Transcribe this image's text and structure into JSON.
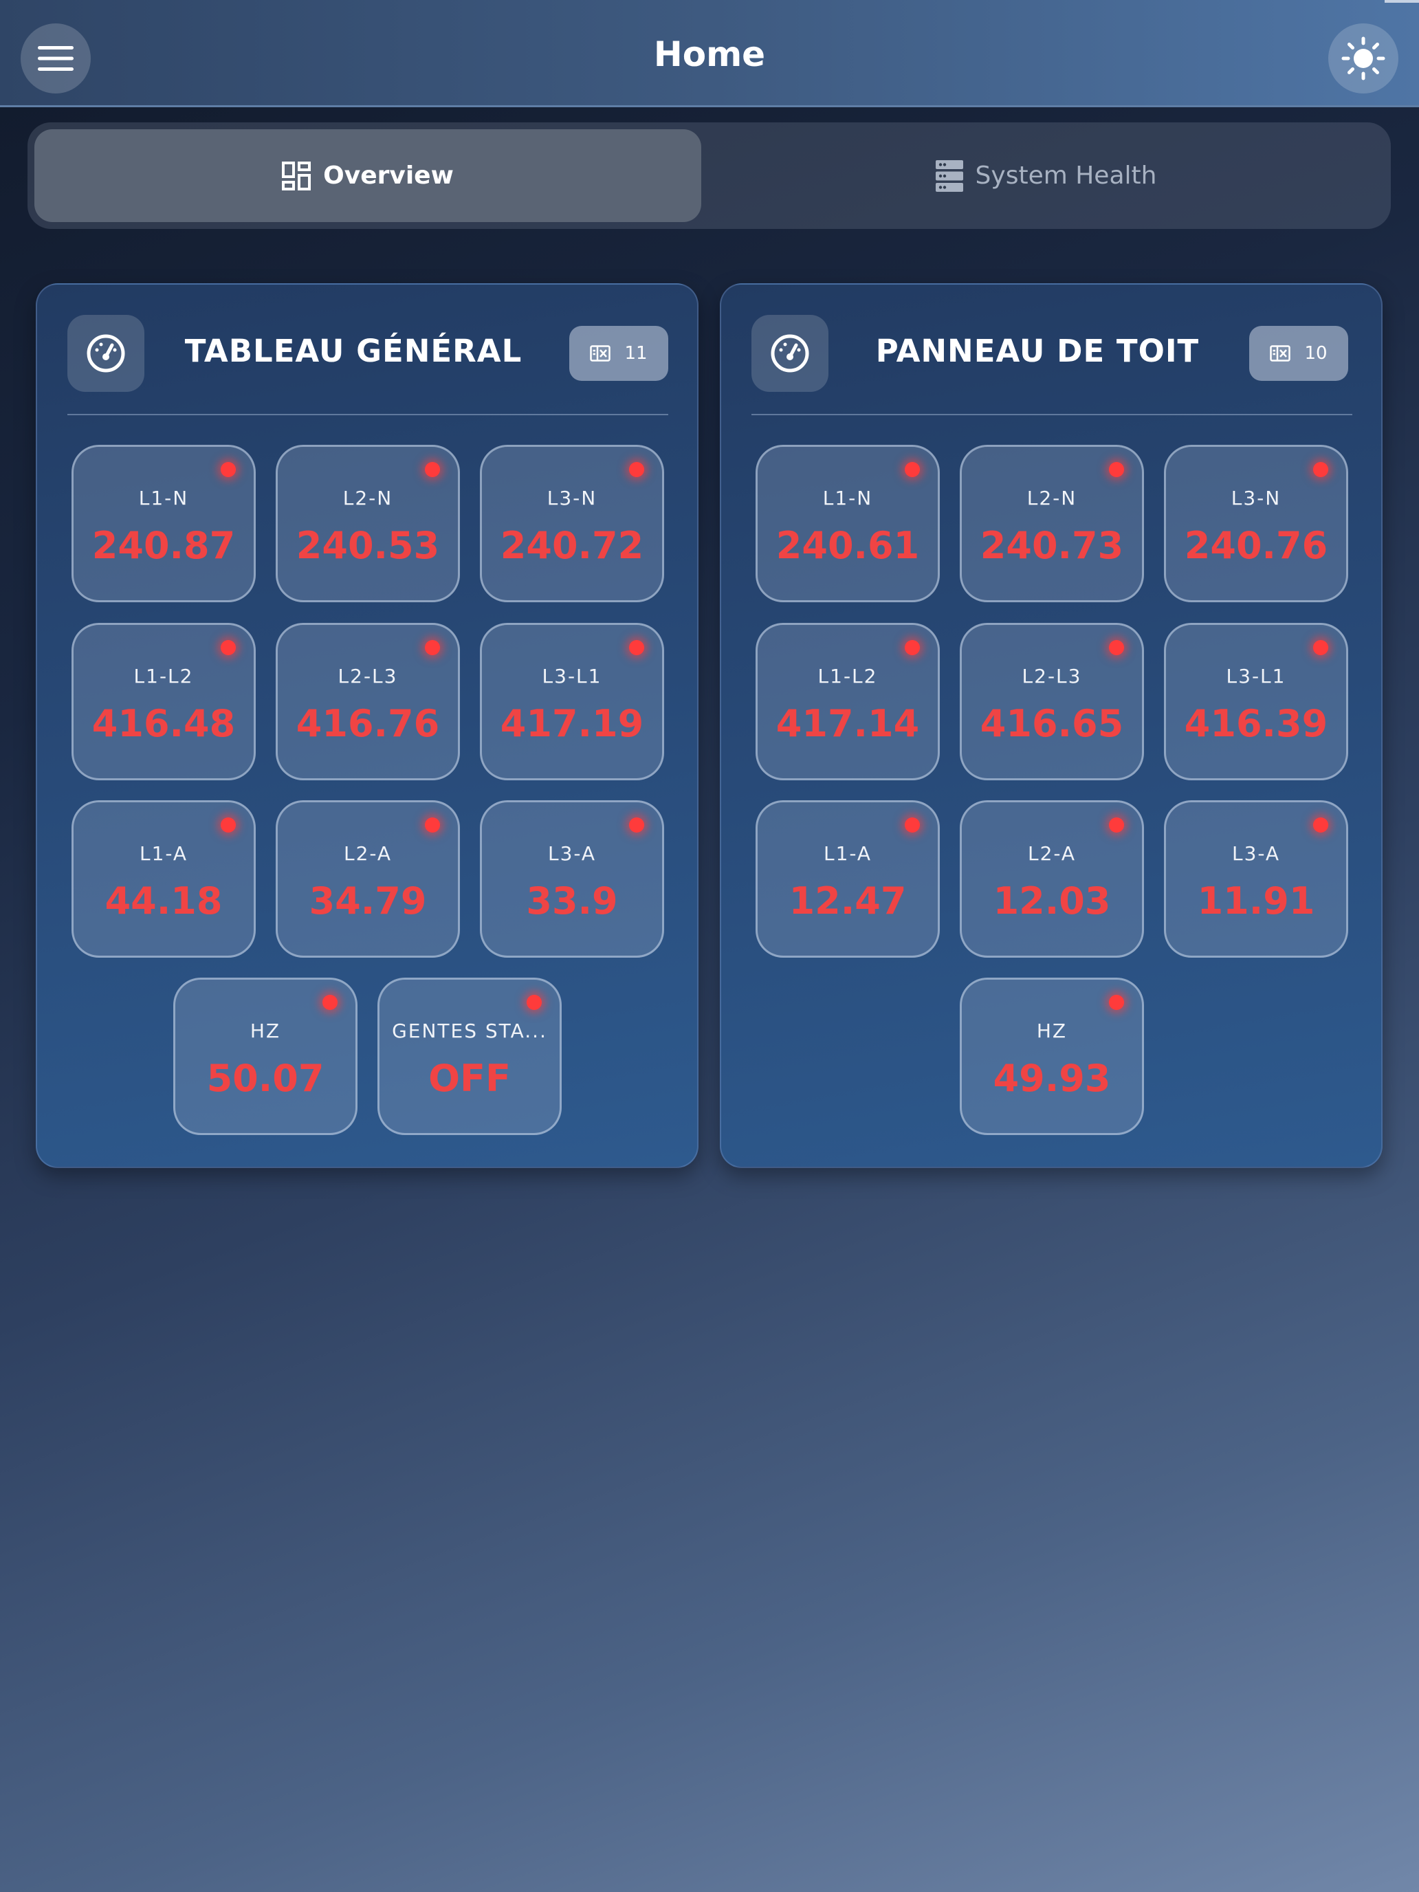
{
  "header": {
    "title": "Home"
  },
  "tabs": [
    {
      "label": "Overview",
      "active": true,
      "icon": "dashboard-icon"
    },
    {
      "label": "System Health",
      "active": false,
      "icon": "server-icon"
    }
  ],
  "colors": {
    "value_red": "#f04444",
    "status_dot": "#ff3b3b"
  },
  "panels": [
    {
      "title": "TABLEAU GÉNÉRAL",
      "count": "11",
      "tiles": [
        {
          "label": "L1-N",
          "value": "240.87"
        },
        {
          "label": "L2-N",
          "value": "240.53"
        },
        {
          "label": "L3-N",
          "value": "240.72"
        },
        {
          "label": "L1-L2",
          "value": "416.48"
        },
        {
          "label": "L2-L3",
          "value": "416.76"
        },
        {
          "label": "L3-L1",
          "value": "417.19"
        },
        {
          "label": "L1-A",
          "value": "44.18"
        },
        {
          "label": "L2-A",
          "value": "34.79"
        },
        {
          "label": "L3-A",
          "value": "33.9"
        },
        {
          "label": "HZ",
          "value": "50.07"
        },
        {
          "label": "GENTES STA...",
          "value": "OFF"
        }
      ]
    },
    {
      "title": "PANNEAU DE TOIT",
      "count": "10",
      "tiles": [
        {
          "label": "L1-N",
          "value": "240.61"
        },
        {
          "label": "L2-N",
          "value": "240.73"
        },
        {
          "label": "L3-N",
          "value": "240.76"
        },
        {
          "label": "L1-L2",
          "value": "417.14"
        },
        {
          "label": "L2-L3",
          "value": "416.65"
        },
        {
          "label": "L3-L1",
          "value": "416.39"
        },
        {
          "label": "L1-A",
          "value": "12.47"
        },
        {
          "label": "L2-A",
          "value": "12.03"
        },
        {
          "label": "L3-A",
          "value": "11.91"
        },
        {
          "label": "HZ",
          "value": "49.93"
        }
      ]
    }
  ]
}
